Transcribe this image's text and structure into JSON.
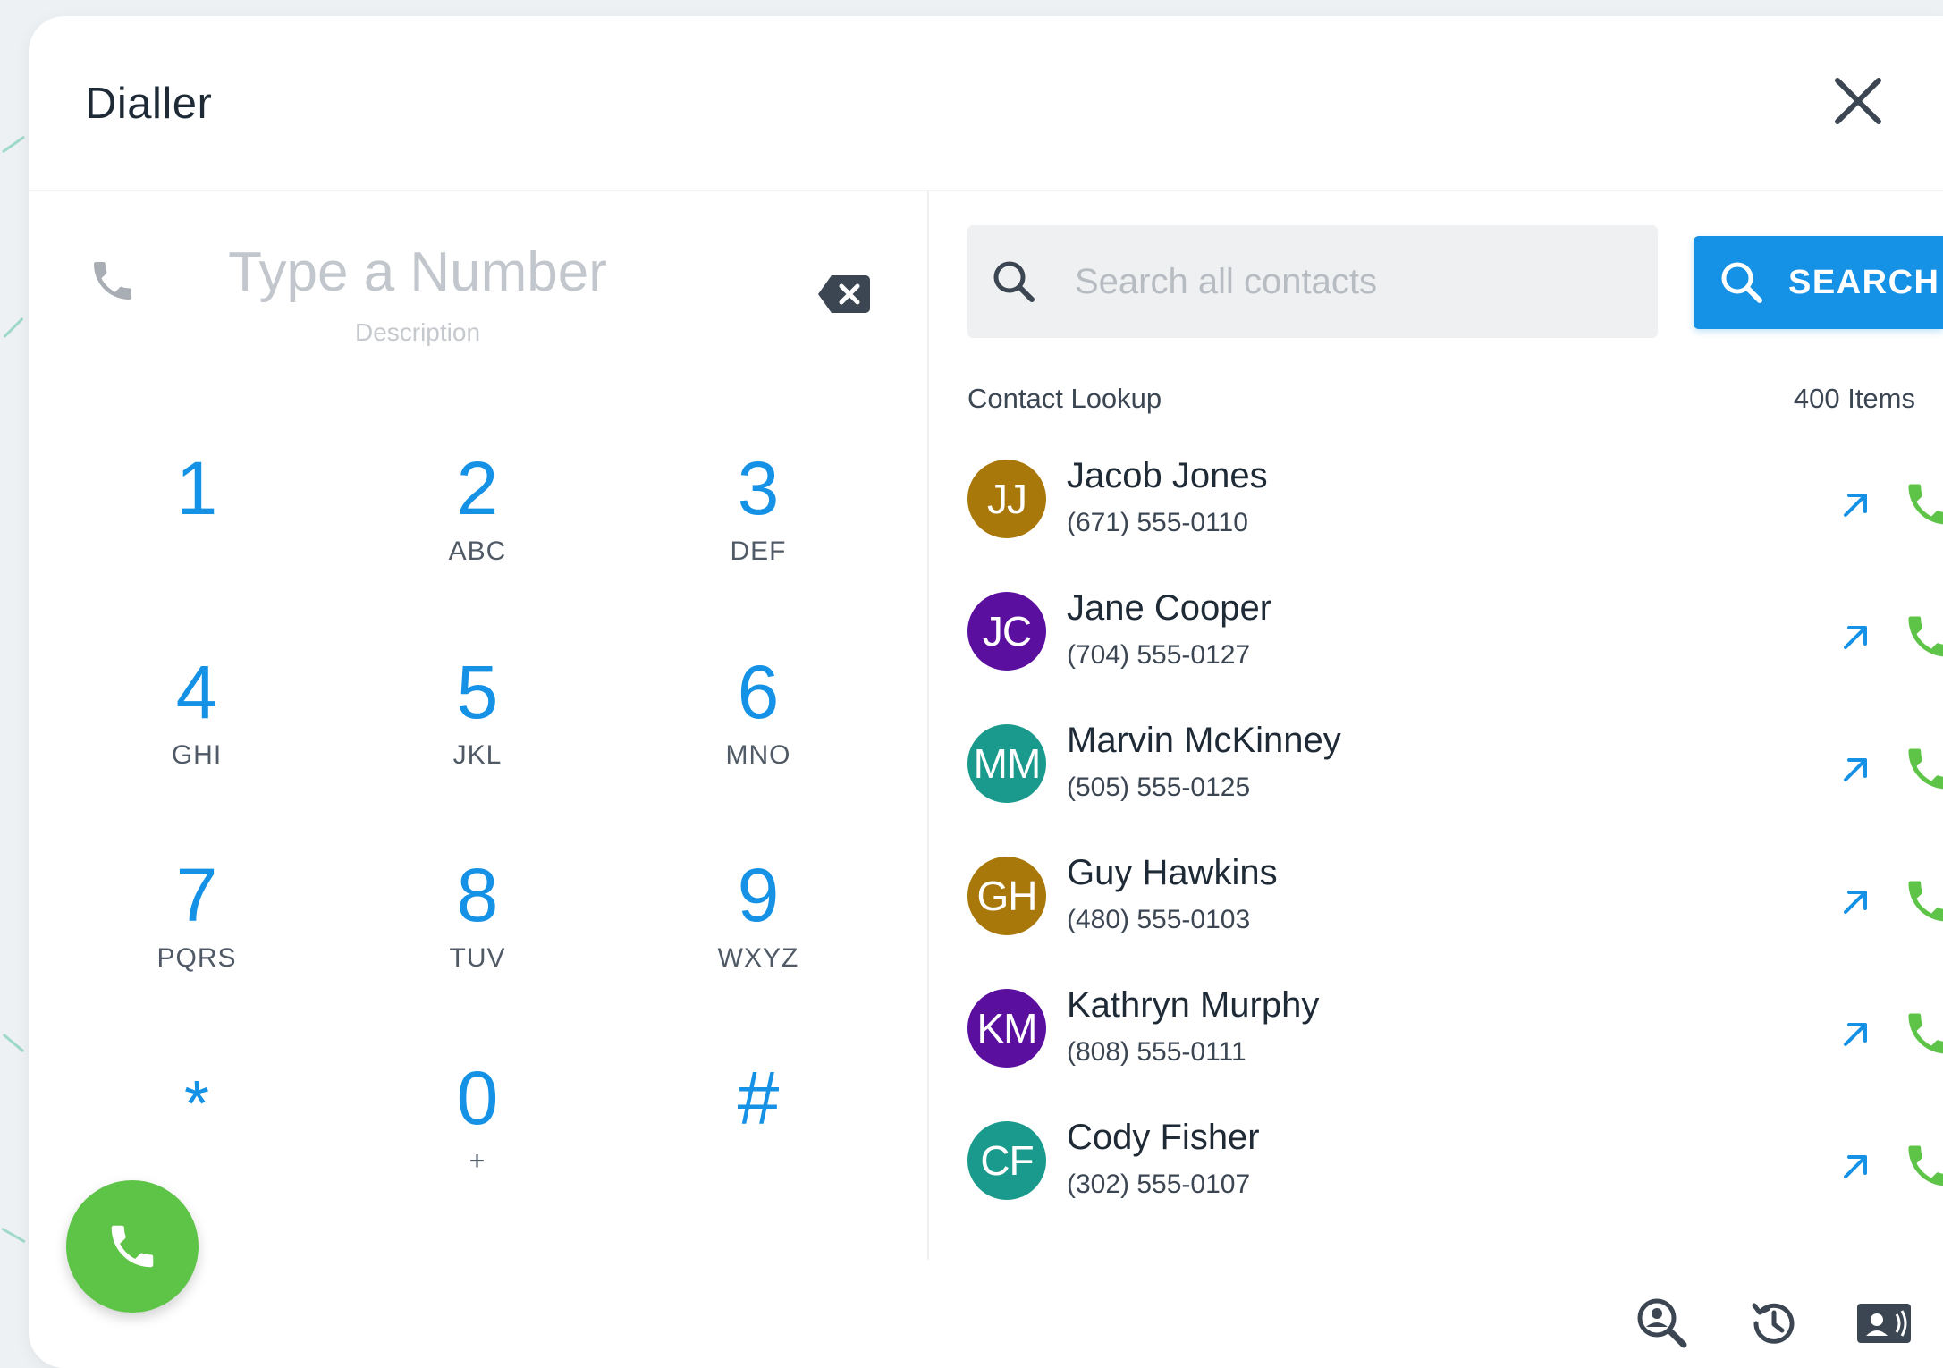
{
  "dialog": {
    "title": "Dialler",
    "close_icon": "close-icon"
  },
  "dialpad": {
    "number_placeholder": "Type a Number",
    "number_value": "",
    "description_placeholder": "Description",
    "keys": [
      {
        "digit": "1",
        "letters": ""
      },
      {
        "digit": "2",
        "letters": "ABC"
      },
      {
        "digit": "3",
        "letters": "DEF"
      },
      {
        "digit": "4",
        "letters": "GHI"
      },
      {
        "digit": "5",
        "letters": "JKL"
      },
      {
        "digit": "6",
        "letters": "MNO"
      },
      {
        "digit": "7",
        "letters": "PQRS"
      },
      {
        "digit": "8",
        "letters": "TUV"
      },
      {
        "digit": "9",
        "letters": "WXYZ"
      },
      {
        "digit": "*",
        "letters": ""
      },
      {
        "digit": "0",
        "letters": "+"
      },
      {
        "digit": "#",
        "letters": ""
      }
    ],
    "call_color": "#5ec447"
  },
  "search": {
    "placeholder": "Search all contacts",
    "value": "",
    "button_label": "SEARCH",
    "accent": "#1592e6"
  },
  "contacts": {
    "section_label": "Contact Lookup",
    "count_label": "400 Items",
    "items": [
      {
        "initials": "JJ",
        "name": "Jacob Jones",
        "phone": "(671) 555-0110",
        "color": "#a9780a"
      },
      {
        "initials": "JC",
        "name": "Jane Cooper",
        "phone": "(704) 555-0127",
        "color": "#5b0f9f"
      },
      {
        "initials": "MM",
        "name": "Marvin McKinney",
        "phone": "(505) 555-0125",
        "color": "#1a9a8c"
      },
      {
        "initials": "GH",
        "name": "Guy Hawkins",
        "phone": "(480) 555-0103",
        "color": "#a9780a"
      },
      {
        "initials": "KM",
        "name": "Kathryn Murphy",
        "phone": "(808) 555-0111",
        "color": "#5b0f9f"
      },
      {
        "initials": "CF",
        "name": "Cody Fisher",
        "phone": "(302) 555-0107",
        "color": "#1a9a8c"
      }
    ]
  },
  "footer_icons": [
    "contact-search-icon",
    "history-icon",
    "contact-card-icon"
  ]
}
